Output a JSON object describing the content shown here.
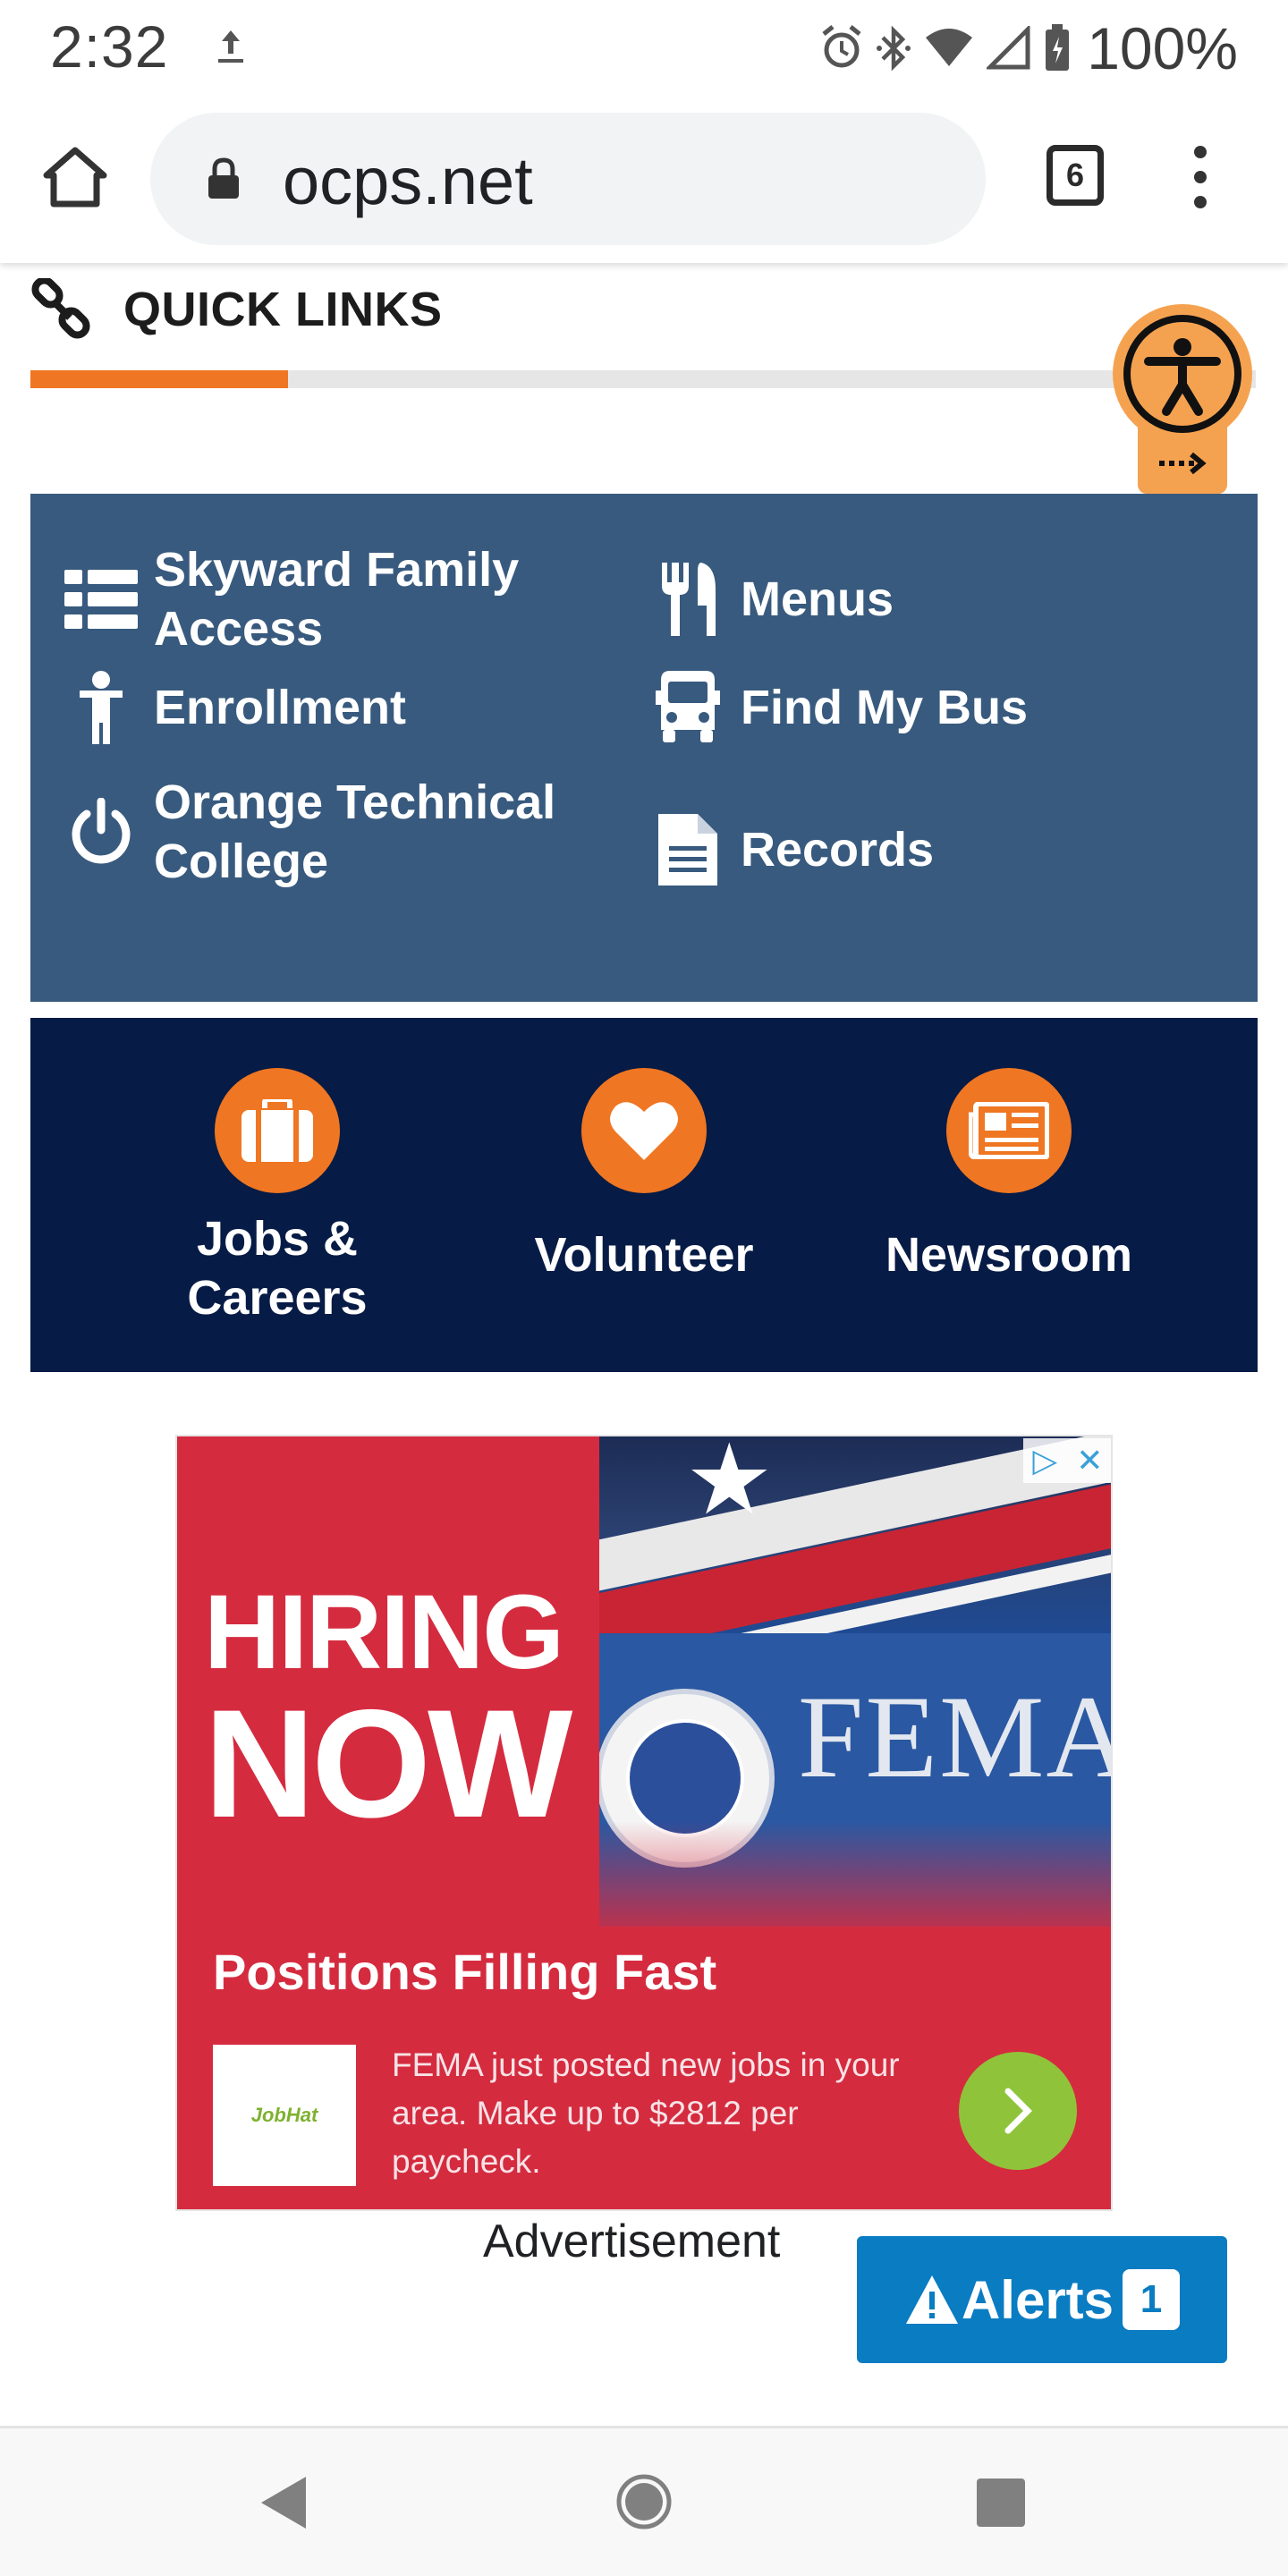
{
  "status_bar": {
    "time": "2:32",
    "battery": "100%",
    "icons": [
      "upload-icon",
      "alarm-icon",
      "bluetooth-icon",
      "wifi-icon",
      "signal-icon",
      "battery-icon"
    ]
  },
  "browser": {
    "url": "ocps.net",
    "tab_count": "6"
  },
  "quick_links": {
    "title": "QUICK LINKS",
    "progress_fraction": 0.21,
    "items": [
      {
        "label_line1": "Skyward Family",
        "label_line2": "Access",
        "icon": "list-icon"
      },
      {
        "label_line1": "Menus",
        "label_line2": "",
        "icon": "utensils-icon"
      },
      {
        "label_line1": "Enrollment",
        "label_line2": "",
        "icon": "child-icon"
      },
      {
        "label_line1": "Find My Bus",
        "label_line2": "",
        "icon": "bus-icon"
      },
      {
        "label_line1": "Orange Technical",
        "label_line2": "College",
        "icon": "power-icon"
      },
      {
        "label_line1": "Records",
        "label_line2": "",
        "icon": "document-icon"
      }
    ]
  },
  "features": [
    {
      "line1": "Jobs &",
      "line2": "Careers",
      "icon": "briefcase-icon"
    },
    {
      "line1": "Volunteer",
      "line2": "",
      "icon": "heart-icon"
    },
    {
      "line1": "Newsroom",
      "line2": "",
      "icon": "newspaper-icon"
    }
  ],
  "ad": {
    "hiring": "HIRING",
    "now": "NOW",
    "photo_text": "FEMA",
    "headline": "Positions Filling Fast",
    "logo_text": "JobHat",
    "body": "FEMA just posted new jobs in your area. Make up to $2812 per paycheck.",
    "caption": "Advertisement"
  },
  "alerts": {
    "label": "Alerts",
    "count": "1"
  },
  "colors": {
    "accent_orange": "#ef7622",
    "quick_links_bg": "#385a7e",
    "feature_bg": "#061b45",
    "alerts_blue": "#0a7cc2",
    "ad_red": "#d52b3f"
  }
}
